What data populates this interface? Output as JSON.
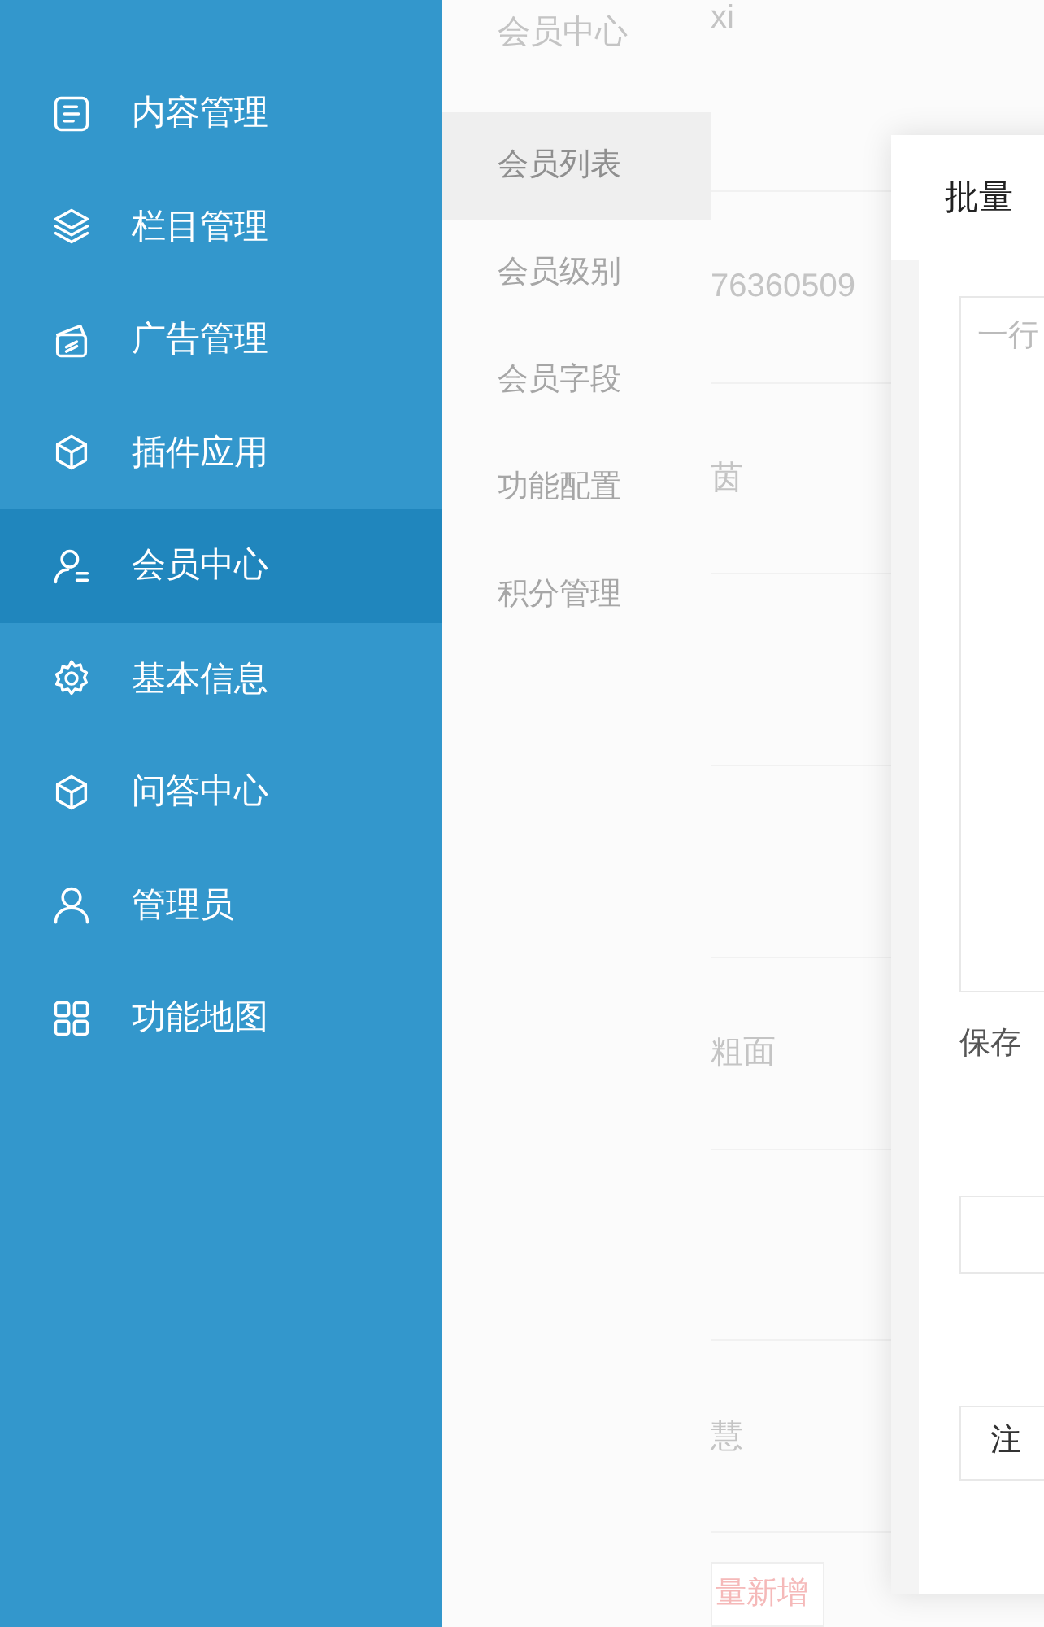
{
  "sidebar": {
    "items": [
      {
        "label": "内容管理",
        "kind": "doc",
        "selected": false
      },
      {
        "label": "栏目管理",
        "kind": "layers",
        "selected": false
      },
      {
        "label": "广告管理",
        "kind": "card",
        "selected": false
      },
      {
        "label": "插件应用",
        "kind": "cube",
        "selected": false
      },
      {
        "label": "会员中心",
        "kind": "member",
        "selected": true
      },
      {
        "label": "基本信息",
        "kind": "gear",
        "selected": false
      },
      {
        "label": "问答中心",
        "kind": "cube",
        "selected": false
      },
      {
        "label": "管理员",
        "kind": "user",
        "selected": false
      },
      {
        "label": "功能地图",
        "kind": "grid",
        "selected": false
      }
    ]
  },
  "submenu": {
    "title": "会员中心",
    "items": [
      {
        "label": "会员列表",
        "selected": true
      },
      {
        "label": "会员级别",
        "selected": false
      },
      {
        "label": "会员字段",
        "selected": false
      },
      {
        "label": "功能配置",
        "selected": false
      },
      {
        "label": "积分管理",
        "selected": false
      }
    ]
  },
  "table": {
    "rows": [
      {
        "column_1": "xi"
      },
      {
        "column_1": "76360509"
      },
      {
        "column_1": "茵"
      },
      {},
      {},
      {
        "column_1": "粗面"
      },
      {},
      {
        "column_1": "慧"
      }
    ],
    "button": "量新增"
  },
  "dialog": {
    "title": "批量",
    "textarea_placeholder": "一行",
    "save_label": "保存",
    "register_button": "注"
  }
}
